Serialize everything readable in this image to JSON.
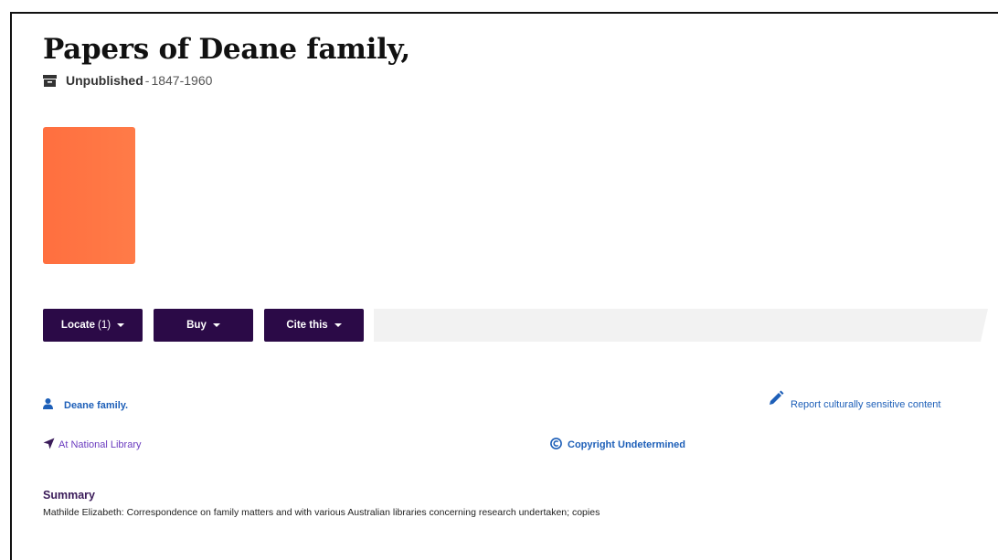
{
  "record": {
    "title": "Papers of Deane family,",
    "format": "Unpublished",
    "separator": "-",
    "years": "1847-1960",
    "format_icon": "archive-box-icon",
    "cover_color": "#ff7b48"
  },
  "actions": {
    "locate_label": "Locate",
    "locate_count": "(1)",
    "buy_label": "Buy",
    "cite_label": "Cite this",
    "button_color": "#2b0a47"
  },
  "details": {
    "creator": "Deane family.",
    "creator_icon": "person-icon",
    "location": "At National Library",
    "location_icon": "location-arrow-icon",
    "copyright": "Copyright Undetermined",
    "copyright_icon": "copyright-icon",
    "report": "Report culturally sensitive content",
    "report_icon": "pencil-icon"
  },
  "summary": {
    "heading": "Summary",
    "text": "Mathilde Elizabeth: Correspondence on family matters and with various Australian libraries concerning research undertaken; copies"
  }
}
